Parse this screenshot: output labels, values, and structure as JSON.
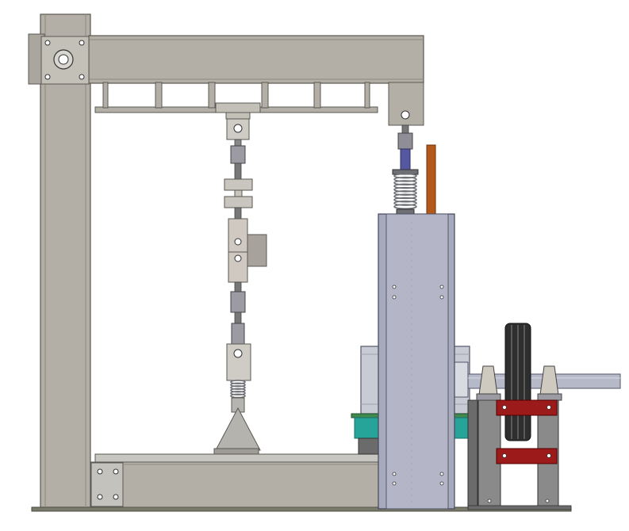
{
  "colors": {
    "background": "#ffffff",
    "frame_steel": "#b3afa6",
    "frame_edge": "#5a5852",
    "column_blue": "#a7aabd",
    "motor_grey": "#c9cbd4",
    "shaft": "#b6b9c8",
    "spring_blue": "#5557a0",
    "spring_coil": "#6d6f74",
    "rod_orange": "#b35a1a",
    "clamp_red": "#9c1a1a",
    "base_teal": "#27a49a",
    "base_green": "#3f8a4f",
    "pulley_black": "#2e2e2e",
    "support_grey": "#6b6b6b"
  },
  "components": [
    "vertical-column-left",
    "top-crossbeam",
    "hanging-bracket-truss",
    "load-string-left",
    "load-string-right",
    "spring-damper",
    "guide-rod",
    "vertical-housing",
    "electric-motor",
    "drive-shaft",
    "v-belt-pulley",
    "bearing-blocks",
    "clamp-bars",
    "base-frame",
    "base-beam"
  ]
}
